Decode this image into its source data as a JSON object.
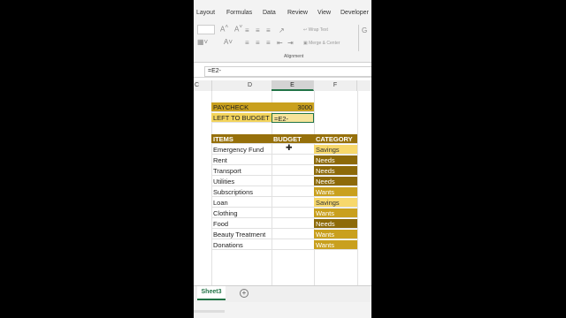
{
  "ribbon_tabs": [
    "Layout",
    "Formulas",
    "Data",
    "Review",
    "View",
    "Developer"
  ],
  "ribbon": {
    "wrap_text": "Wrap Text",
    "merge_center": "Merge & Center",
    "group_label": "Alignment"
  },
  "formula_bar": {
    "content": "=E2-"
  },
  "columns": [
    "C",
    "D",
    "E",
    "F"
  ],
  "summary": {
    "paycheck_label": "PAYCHECK",
    "paycheck_value": "3000",
    "left_label": "LEFT TO BUDGET",
    "left_value": "=E2-"
  },
  "table": {
    "headers": [
      "ITEMS",
      "BUDGET",
      "CATEGORY"
    ],
    "rows": [
      {
        "item": "Emergency Fund",
        "category": "Savings"
      },
      {
        "item": "Rent",
        "category": "Needs"
      },
      {
        "item": "Transport",
        "category": "Needs"
      },
      {
        "item": "Utilities",
        "category": "Needs"
      },
      {
        "item": "Subscriptions",
        "category": "Wants"
      },
      {
        "item": "Loan",
        "category": "Savings"
      },
      {
        "item": "Clothing",
        "category": "Wants"
      },
      {
        "item": "Food",
        "category": "Needs"
      },
      {
        "item": "Beauty Treatment",
        "category": "Wants"
      },
      {
        "item": "Donations",
        "category": "Wants"
      }
    ]
  },
  "sheet_tab": "Sheet3",
  "colors": {
    "header_gold": "#96700b",
    "needs": "#8d6a09",
    "wants": "#c9a01e",
    "savings": "#f7d86b",
    "excel_green": "#217346"
  }
}
